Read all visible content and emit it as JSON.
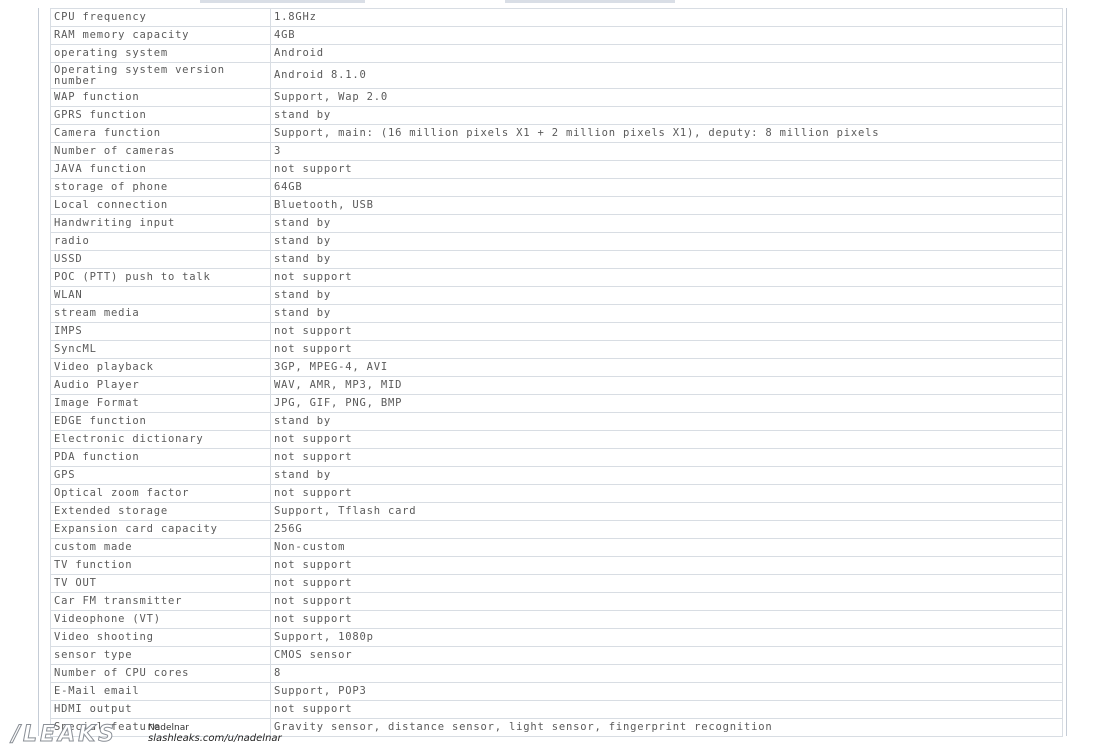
{
  "spec_table": {
    "rows": [
      {
        "label": "CPU frequency",
        "value": "1.8GHz"
      },
      {
        "label": "RAM memory capacity",
        "value": "4GB"
      },
      {
        "label": "operating system",
        "value": "Android"
      },
      {
        "label": "Operating system version number",
        "value": "Android 8.1.0"
      },
      {
        "label": "WAP function",
        "value": "Support, Wap 2.0"
      },
      {
        "label": "GPRS function",
        "value": "stand by"
      },
      {
        "label": "Camera function",
        "value": "Support, main: (16 million pixels X1 + 2 million pixels X1), deputy: 8 million pixels"
      },
      {
        "label": "Number of cameras",
        "value": "3"
      },
      {
        "label": "JAVA function",
        "value": "not support"
      },
      {
        "label": "storage of phone",
        "value": "64GB"
      },
      {
        "label": "Local connection",
        "value": "Bluetooth, USB"
      },
      {
        "label": "Handwriting input",
        "value": "stand by"
      },
      {
        "label": "radio",
        "value": "stand by"
      },
      {
        "label": "USSD",
        "value": "stand by"
      },
      {
        "label": "POC (PTT) push to talk",
        "value": "not support"
      },
      {
        "label": "WLAN",
        "value": "stand by"
      },
      {
        "label": "stream media",
        "value": "stand by"
      },
      {
        "label": "IMPS",
        "value": "not support"
      },
      {
        "label": "SyncML",
        "value": "not support"
      },
      {
        "label": "Video playback",
        "value": "3GP, MPEG-4, AVI"
      },
      {
        "label": "Audio Player",
        "value": "WAV, AMR, MP3, MID"
      },
      {
        "label": "Image Format",
        "value": "JPG, GIF, PNG, BMP"
      },
      {
        "label": "EDGE function",
        "value": "stand by"
      },
      {
        "label": "Electronic dictionary",
        "value": "not support"
      },
      {
        "label": "PDA function",
        "value": "not support"
      },
      {
        "label": "GPS",
        "value": "stand by"
      },
      {
        "label": "Optical zoom factor",
        "value": "not support"
      },
      {
        "label": "Extended storage",
        "value": "Support, Tflash card"
      },
      {
        "label": "Expansion card capacity",
        "value": "256G"
      },
      {
        "label": "custom made",
        "value": "Non-custom"
      },
      {
        "label": "TV function",
        "value": "not support"
      },
      {
        "label": "TV OUT",
        "value": "not support"
      },
      {
        "label": "Car FM transmitter",
        "value": "not support"
      },
      {
        "label": "Videophone (VT)",
        "value": "not support"
      },
      {
        "label": "Video shooting",
        "value": "Support, 1080p"
      },
      {
        "label": "sensor type",
        "value": "CMOS sensor"
      },
      {
        "label": "Number of CPU cores",
        "value": "8"
      },
      {
        "label": "E-Mail email",
        "value": "Support, POP3"
      },
      {
        "label": "HDMI output",
        "value": "not support"
      },
      {
        "label": "Special feature",
        "value": "Gravity sensor, distance sensor, light sensor, fingerprint recognition"
      }
    ]
  },
  "watermark": {
    "logo": "/LEAKS",
    "user": "Nadelnar",
    "url": "slashleaks.com/u/nadelnar"
  }
}
